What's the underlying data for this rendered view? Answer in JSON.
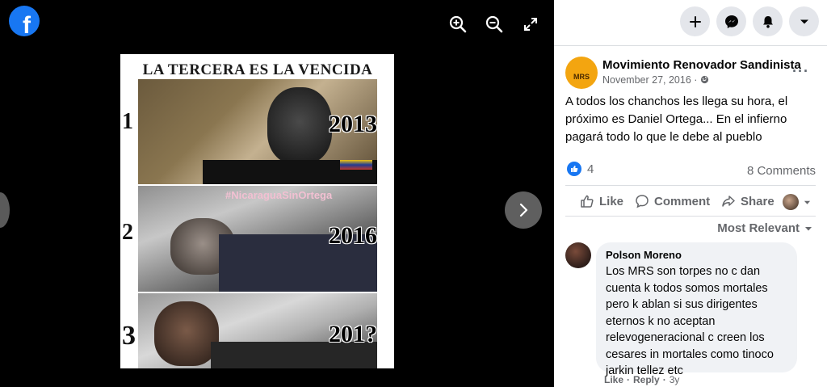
{
  "viewer": {
    "icons": [
      "facebook-logo",
      "zoom-in-icon",
      "zoom-out-icon",
      "fullscreen-icon",
      "chevron-right-icon"
    ],
    "meme": {
      "title": "LA TERCERA ES LA VENCIDA",
      "panels": [
        {
          "number": "1",
          "year": "2013"
        },
        {
          "number": "2",
          "year": "2016"
        },
        {
          "number": "3",
          "year": "201?"
        }
      ],
      "hashtag": "#NicaraguaSinOrtega"
    }
  },
  "header": {
    "icons": [
      "plus-icon",
      "messenger-icon",
      "bell-icon",
      "caret-down-icon"
    ]
  },
  "post": {
    "page_name": "Movimiento Renovador Sandinista",
    "avatar_text": "MRS",
    "date": "November 27, 2016 · ",
    "text": "A todos los chanchos les llega su hora, el próximo es Daniel Ortega... En el infierno pagará todo lo que le debe al pueblo",
    "reaction_count": "4",
    "comments_label": "8 Comments",
    "actions": {
      "like": "Like",
      "comment": "Comment",
      "share": "Share"
    },
    "sort_label": "Most Relevant"
  },
  "comment": {
    "author": "Polson Moreno",
    "text": "Los MRS son torpes no c dan cuenta k todos somos mortales pero k ablan si sus dirigentes eternos k no aceptan relevogeneracional c creen los cesares in mortales como tinoco jarkin tellez etc",
    "like": "Like",
    "reply": "Reply",
    "separator": "·",
    "time": "3y"
  },
  "colors": {
    "brand": "#1877f2",
    "avatar_orange": "#f3a510"
  }
}
